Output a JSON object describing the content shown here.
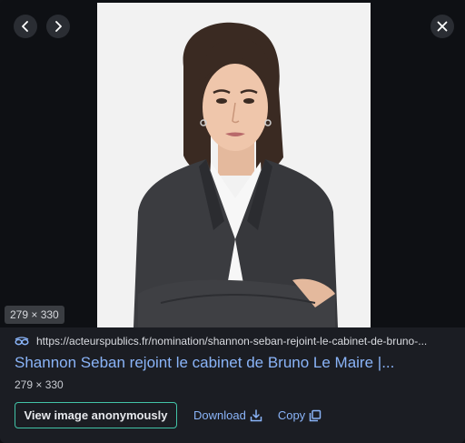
{
  "viewer": {
    "size_badge": "279 × 330",
    "prev_icon": "chevron-left-icon",
    "next_icon": "chevron-right-icon",
    "close_icon": "close-icon"
  },
  "result": {
    "source_url": "https://acteurspublics.fr/nomination/shannon-seban-rejoint-le-cabinet-de-bruno-...",
    "title": "Shannon Seban rejoint le cabinet de Bruno Le Maire |...",
    "dimensions": "279 × 330"
  },
  "actions": {
    "view_anonymously": "View image anonymously",
    "download": "Download",
    "copy": "Copy"
  },
  "colors": {
    "accent_link": "#8ab4f8",
    "button_border": "#42c3a7",
    "panel_bg": "#1b1d23"
  }
}
